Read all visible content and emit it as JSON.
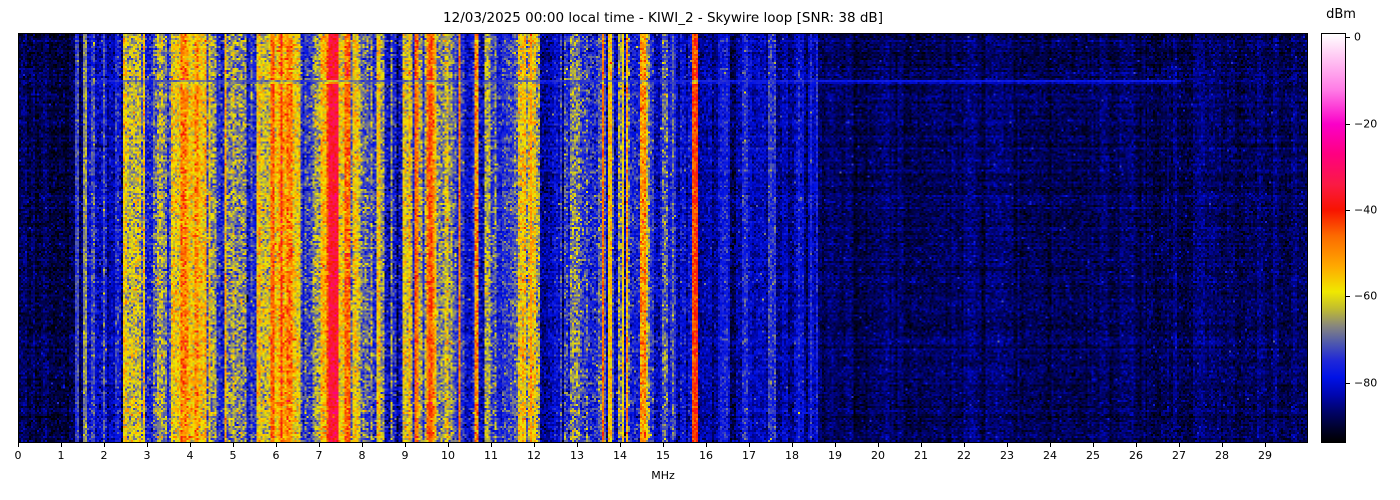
{
  "chart_data": {
    "type": "heatmap",
    "title": "12/03/2025 00:00 local time - KIWI_2 - Skywire loop [SNR: 38 dB]",
    "datetime_label": "12/03/2025 00:00 local time",
    "station": "KIWI_2",
    "antenna": "Skywire loop",
    "snr_label": "SNR: 38 dB",
    "xlabel": "MHz",
    "x_range_mhz": [
      0,
      30
    ],
    "x_ticks": [
      0,
      1,
      2,
      3,
      4,
      5,
      6,
      7,
      8,
      9,
      10,
      11,
      12,
      13,
      14,
      15,
      16,
      17,
      18,
      19,
      20,
      21,
      22,
      23,
      24,
      25,
      26,
      27,
      28,
      29
    ],
    "y_axis": "time (no tick labels shown, newest at top, one night of waterfall rows)",
    "grid": false,
    "colorbar": {
      "label": "dBm",
      "ticks": [
        0,
        -20,
        -40,
        -60,
        -80
      ],
      "domain_top": 1,
      "domain_bottom": -94,
      "colormap_stops": [
        [
          1,
          "#ffffff"
        ],
        [
          -4,
          "#ffccf4"
        ],
        [
          -12,
          "#ff7ce6"
        ],
        [
          -20,
          "#fa00c8"
        ],
        [
          -27,
          "#ff0080"
        ],
        [
          -34,
          "#fa1a45"
        ],
        [
          -40,
          "#f81400"
        ],
        [
          -46,
          "#fc6a00"
        ],
        [
          -53,
          "#ffa800"
        ],
        [
          -59,
          "#f0e800"
        ],
        [
          -63,
          "#c0bc30"
        ],
        [
          -67,
          "#87867e"
        ],
        [
          -71,
          "#4e58ae"
        ],
        [
          -75,
          "#2028d8"
        ],
        [
          -79,
          "#0012e6"
        ],
        [
          -83,
          "#0006b0"
        ],
        [
          -87,
          "#000368"
        ],
        [
          -91,
          "#000128"
        ],
        [
          -94,
          "#000000"
        ]
      ]
    },
    "render": {
      "cols": 645,
      "rows": 205,
      "seed": 20251203,
      "noise_floor_dbm": -89
    },
    "bands_mhz_level_dbm": [
      [
        0.0,
        1.5,
        -89,
        1.5,
        2.5
      ],
      [
        1.5,
        1.57,
        -70,
        3.0,
        3.0
      ],
      [
        1.57,
        1.8,
        -80,
        4.0,
        3.5
      ],
      [
        1.8,
        2.06,
        -77,
        4.5,
        4.0
      ],
      [
        2.06,
        2.22,
        -84,
        3.0,
        3.0
      ],
      [
        2.22,
        2.44,
        -77,
        4.5,
        4.0
      ],
      [
        2.44,
        2.8,
        -60,
        5.0,
        5.0
      ],
      [
        2.8,
        2.92,
        -64,
        5.0,
        5.0
      ],
      [
        2.92,
        3.18,
        -74,
        5.0,
        4.5
      ],
      [
        3.18,
        3.42,
        -63,
        6.0,
        5.0
      ],
      [
        3.42,
        3.52,
        -74,
        4.0,
        4.0
      ],
      [
        3.52,
        4.05,
        -52,
        4.5,
        5.0
      ],
      [
        4.05,
        4.28,
        -55,
        5.0,
        5.0
      ],
      [
        4.28,
        4.62,
        -60,
        6.0,
        5.0
      ],
      [
        4.62,
        4.85,
        -71,
        6.0,
        5.0
      ],
      [
        4.85,
        5.35,
        -64,
        7.0,
        5.5
      ],
      [
        5.35,
        5.55,
        -74,
        5.0,
        4.5
      ],
      [
        5.55,
        5.85,
        -65,
        6.0,
        5.0
      ],
      [
        5.85,
        5.95,
        -48,
        4.0,
        4.0
      ],
      [
        5.95,
        6.35,
        -52,
        5.0,
        5.0
      ],
      [
        6.35,
        6.6,
        -60,
        6.0,
        5.0
      ],
      [
        6.6,
        6.9,
        -73,
        6.0,
        5.0
      ],
      [
        6.9,
        7.15,
        -63,
        6.0,
        5.0
      ],
      [
        7.15,
        7.44,
        -38,
        3.5,
        4.0
      ],
      [
        7.44,
        7.7,
        -53,
        5.0,
        5.0
      ],
      [
        7.7,
        7.95,
        -60,
        5.5,
        5.0
      ],
      [
        7.95,
        8.2,
        -73,
        6.0,
        5.0
      ],
      [
        8.2,
        8.5,
        -62,
        6.5,
        5.0
      ],
      [
        8.5,
        8.95,
        -75,
        5.5,
        5.0
      ],
      [
        8.95,
        9.15,
        -66,
        6.0,
        5.0
      ],
      [
        9.15,
        9.5,
        -70,
        6.0,
        5.0
      ],
      [
        9.5,
        9.66,
        -47,
        4.5,
        4.5
      ],
      [
        9.66,
        10.0,
        -59,
        6.0,
        5.0
      ],
      [
        10.0,
        10.2,
        -73,
        5.0,
        4.5
      ],
      [
        10.2,
        10.6,
        -77,
        4.5,
        4.0
      ],
      [
        10.6,
        10.72,
        -65,
        6.0,
        5.5
      ],
      [
        10.72,
        11.1,
        -73,
        6.0,
        5.0
      ],
      [
        11.1,
        11.62,
        -77,
        4.5,
        4.0
      ],
      [
        11.62,
        12.14,
        -62,
        5.5,
        5.5
      ],
      [
        12.14,
        12.72,
        -81,
        4.0,
        3.5
      ],
      [
        12.72,
        13.48,
        -72,
        5.5,
        5.0
      ],
      [
        13.48,
        13.95,
        -76,
        4.5,
        4.0
      ],
      [
        13.95,
        14.25,
        -64,
        6.0,
        5.5
      ],
      [
        14.25,
        14.45,
        -74,
        5.0,
        4.5
      ],
      [
        14.45,
        14.68,
        -61,
        6.0,
        5.0
      ],
      [
        14.68,
        14.97,
        -76,
        4.5,
        4.0
      ],
      [
        14.97,
        15.12,
        -68,
        5.5,
        5.0
      ],
      [
        15.12,
        15.68,
        -79,
        4.0,
        3.5
      ],
      [
        15.68,
        15.8,
        -46,
        2.5,
        3.0
      ],
      [
        15.8,
        16.3,
        -84,
        2.5,
        3.0
      ],
      [
        16.3,
        16.55,
        -81,
        3.5,
        3.0
      ],
      [
        16.55,
        16.85,
        -84,
        2.5,
        3.0
      ],
      [
        16.85,
        17.0,
        -79,
        4.0,
        3.5
      ],
      [
        17.0,
        17.45,
        -84,
        2.5,
        3.0
      ],
      [
        17.45,
        17.62,
        -77,
        4.0,
        3.5
      ],
      [
        17.62,
        18.05,
        -84,
        2.5,
        3.0
      ],
      [
        18.05,
        18.22,
        -80,
        4.0,
        3.5
      ],
      [
        18.22,
        18.45,
        -82,
        3.5,
        3.0
      ],
      [
        18.45,
        18.6,
        -80,
        3.5,
        3.0
      ],
      [
        18.6,
        30.0,
        -88,
        1.2,
        2.3
      ]
    ],
    "carriers_mhz_level_dbm": [
      [
        1.35,
        -73,
        0.025
      ],
      [
        1.53,
        -67,
        0.04
      ],
      [
        1.72,
        -72,
        0.025
      ],
      [
        1.98,
        -72,
        0.025
      ],
      [
        7.28,
        -36,
        0.06
      ],
      [
        9.27,
        -48,
        0.04
      ],
      [
        9.58,
        -45,
        0.05
      ],
      [
        10.25,
        -48,
        0.04
      ],
      [
        11.93,
        -53,
        0.04
      ],
      [
        12.65,
        -72,
        0.02
      ],
      [
        13.6,
        -47,
        0.04
      ],
      [
        13.77,
        -56,
        0.03
      ],
      [
        14.07,
        -57,
        0.03
      ],
      [
        15.74,
        -44,
        0.05
      ],
      [
        16.93,
        -76,
        0.03
      ],
      [
        17.55,
        -75,
        0.03
      ],
      [
        18.12,
        -78,
        0.03
      ]
    ],
    "events": [
      {
        "row_frac": 0.112,
        "weight": 0.7,
        "target_dbm": -74,
        "f_start": 1.8,
        "f_end": 27.0
      },
      {
        "row_frac": 0.117,
        "weight": 0.35,
        "target_dbm": -74,
        "f_start": 1.8,
        "f_end": 27.0
      }
    ]
  }
}
